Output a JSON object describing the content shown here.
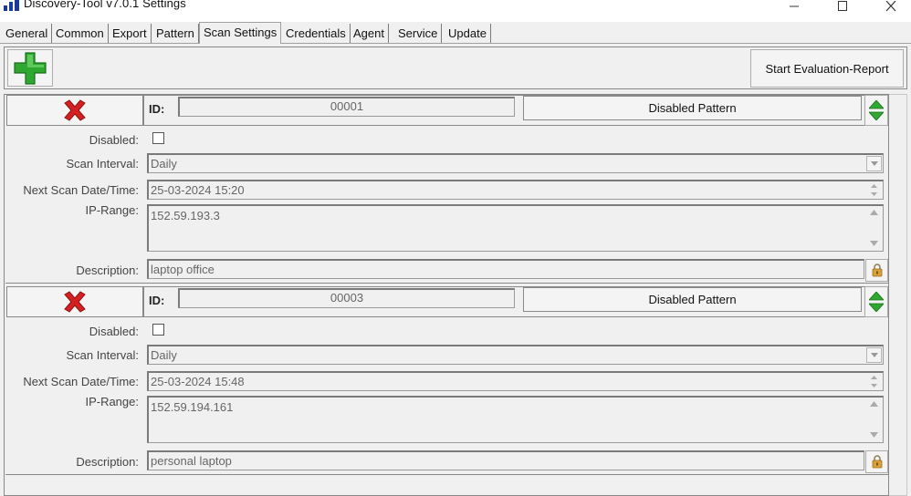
{
  "window": {
    "title": "Discovery-Tool v7.0.1 Settings"
  },
  "tabs": [
    {
      "label": "General"
    },
    {
      "label": "Common"
    },
    {
      "label": "Export"
    },
    {
      "label": "Pattern"
    },
    {
      "label": "Scan Settings",
      "active": true
    },
    {
      "label": "Credentials"
    },
    {
      "label": "Agent"
    },
    {
      "label": "Service"
    },
    {
      "label": "Update"
    }
  ],
  "toolbar": {
    "add_icon": "green-plus-icon",
    "report_label": "Start Evaluation-Report"
  },
  "labels": {
    "id": "ID:",
    "disabled": "Disabled:",
    "scan_interval": "Scan Interval:",
    "next_scan": "Next Scan Date/Time:",
    "ip_range": "IP-Range:",
    "description": "Description:"
  },
  "entries": [
    {
      "id": "00001",
      "pattern": "Disabled Pattern",
      "disabled": false,
      "scan_interval": "Daily",
      "next_scan": "25-03-2024 15:20",
      "ip_range": "152.59.193.3",
      "description": "laptop office"
    },
    {
      "id": "00003",
      "pattern": "Disabled Pattern",
      "disabled": false,
      "scan_interval": "Daily",
      "next_scan": "25-03-2024 15:48",
      "ip_range": "152.59.194.161",
      "description": "personal laptop"
    }
  ],
  "colors": {
    "accent_green": "#2fa82f",
    "delete_red": "#d42020",
    "lock_gold": "#d8a23a"
  }
}
